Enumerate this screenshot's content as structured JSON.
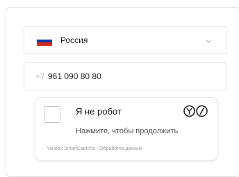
{
  "country_select": {
    "selected": "Россия",
    "flag_colors": [
      "#ffffff",
      "#0039a6",
      "#d52b1e"
    ],
    "icon": "chevron-down-icon"
  },
  "phone_input": {
    "prefix": "+7",
    "value": "961 090 80 80"
  },
  "captcha": {
    "checkbox_label": "Я не робот",
    "hint": "Нажмите, чтобы продолжить",
    "brand": "Yandex SmartCaptcha",
    "separator": " · ",
    "policy_link": "Обработка данных",
    "checked": false
  }
}
